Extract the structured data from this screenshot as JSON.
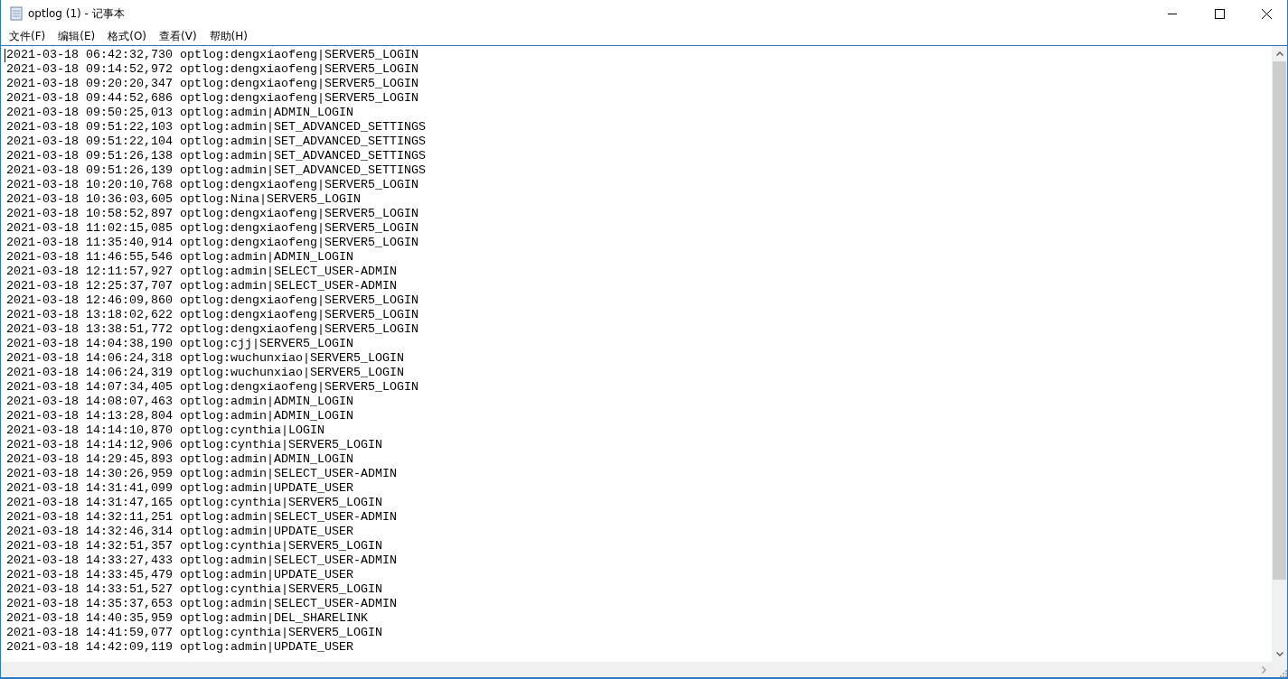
{
  "window": {
    "title": "optlog (1) - 记事本"
  },
  "menu": [
    "文件(F)",
    "编辑(E)",
    "格式(O)",
    "查看(V)",
    "帮助(H)"
  ],
  "lines": [
    "2021-03-18 06:42:32,730 optlog:dengxiaofeng|SERVER5_LOGIN",
    "2021-03-18 09:14:52,972 optlog:dengxiaofeng|SERVER5_LOGIN",
    "2021-03-18 09:20:20,347 optlog:dengxiaofeng|SERVER5_LOGIN",
    "2021-03-18 09:44:52,686 optlog:dengxiaofeng|SERVER5_LOGIN",
    "2021-03-18 09:50:25,013 optlog:admin|ADMIN_LOGIN",
    "2021-03-18 09:51:22,103 optlog:admin|SET_ADVANCED_SETTINGS",
    "2021-03-18 09:51:22,104 optlog:admin|SET_ADVANCED_SETTINGS",
    "2021-03-18 09:51:26,138 optlog:admin|SET_ADVANCED_SETTINGS",
    "2021-03-18 09:51:26,139 optlog:admin|SET_ADVANCED_SETTINGS",
    "2021-03-18 10:20:10,768 optlog:dengxiaofeng|SERVER5_LOGIN",
    "2021-03-18 10:36:03,605 optlog:Nina|SERVER5_LOGIN",
    "2021-03-18 10:58:52,897 optlog:dengxiaofeng|SERVER5_LOGIN",
    "2021-03-18 11:02:15,085 optlog:dengxiaofeng|SERVER5_LOGIN",
    "2021-03-18 11:35:40,914 optlog:dengxiaofeng|SERVER5_LOGIN",
    "2021-03-18 11:46:55,546 optlog:admin|ADMIN_LOGIN",
    "2021-03-18 12:11:57,927 optlog:admin|SELECT_USER-ADMIN",
    "2021-03-18 12:25:37,707 optlog:admin|SELECT_USER-ADMIN",
    "2021-03-18 12:46:09,860 optlog:dengxiaofeng|SERVER5_LOGIN",
    "2021-03-18 13:18:02,622 optlog:dengxiaofeng|SERVER5_LOGIN",
    "2021-03-18 13:38:51,772 optlog:dengxiaofeng|SERVER5_LOGIN",
    "2021-03-18 14:04:38,190 optlog:cjj|SERVER5_LOGIN",
    "2021-03-18 14:06:24,318 optlog:wuchunxiao|SERVER5_LOGIN",
    "2021-03-18 14:06:24,319 optlog:wuchunxiao|SERVER5_LOGIN",
    "2021-03-18 14:07:34,405 optlog:dengxiaofeng|SERVER5_LOGIN",
    "2021-03-18 14:08:07,463 optlog:admin|ADMIN_LOGIN",
    "2021-03-18 14:13:28,804 optlog:admin|ADMIN_LOGIN",
    "2021-03-18 14:14:10,870 optlog:cynthia|LOGIN",
    "2021-03-18 14:14:12,906 optlog:cynthia|SERVER5_LOGIN",
    "2021-03-18 14:29:45,893 optlog:admin|ADMIN_LOGIN",
    "2021-03-18 14:30:26,959 optlog:admin|SELECT_USER-ADMIN",
    "2021-03-18 14:31:41,099 optlog:admin|UPDATE_USER",
    "2021-03-18 14:31:47,165 optlog:cynthia|SERVER5_LOGIN",
    "2021-03-18 14:32:11,251 optlog:admin|SELECT_USER-ADMIN",
    "2021-03-18 14:32:46,314 optlog:admin|UPDATE_USER",
    "2021-03-18 14:32:51,357 optlog:cynthia|SERVER5_LOGIN",
    "2021-03-18 14:33:27,433 optlog:admin|SELECT_USER-ADMIN",
    "2021-03-18 14:33:45,479 optlog:admin|UPDATE_USER",
    "2021-03-18 14:33:51,527 optlog:cynthia|SERVER5_LOGIN",
    "2021-03-18 14:35:37,653 optlog:admin|SELECT_USER-ADMIN",
    "2021-03-18 14:40:35,959 optlog:admin|DEL_SHARELINK",
    "2021-03-18 14:41:59,077 optlog:cynthia|SERVER5_LOGIN",
    "2021-03-18 14:42:09,119 optlog:admin|UPDATE_USER"
  ]
}
